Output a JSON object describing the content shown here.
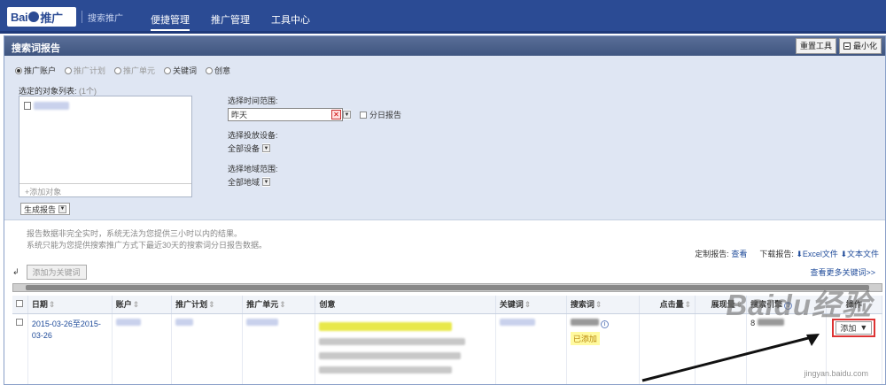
{
  "header": {
    "logo_text": "Bai",
    "logo_suffix": "推广",
    "logo_sub": "搜索推广",
    "nav": [
      {
        "label": "便捷管理",
        "active": true
      },
      {
        "label": "推广管理",
        "active": false
      },
      {
        "label": "工具中心",
        "active": false
      }
    ]
  },
  "panel": {
    "title": "搜索词报告",
    "reset_tool": "重置工具",
    "minimize": "最小化"
  },
  "filter": {
    "levels": [
      {
        "label": "推广账户",
        "checked": true,
        "disabled": false
      },
      {
        "label": "推广计划",
        "checked": false,
        "disabled": true
      },
      {
        "label": "推广单元",
        "checked": false,
        "disabled": true
      },
      {
        "label": "关键词",
        "checked": false,
        "disabled": false
      },
      {
        "label": "创意",
        "checked": false,
        "disabled": false
      }
    ],
    "objects_label": "选定的对象列表:",
    "objects_count": "(1个)",
    "add_object": "+添加对象",
    "generate": "生成报告",
    "time_label": "选择时间范围:",
    "time_value": "昨天",
    "split_by_day": "分日报告",
    "device_label": "选择投放设备:",
    "device_value": "全部设备",
    "region_label": "选择地域范围:",
    "region_value": "全部地域"
  },
  "notes": [
    "报告数据非完全实时，系统无法为您提供三小时以内的结果。",
    "系统只能为您提供搜索推广方式下最近30天的搜索词分日报告数据。"
  ],
  "report_actions": {
    "custom_label": "定制报告:",
    "custom_link": "查看",
    "download_label": "下载报告:",
    "excel": "Excel文件",
    "text": "文本文件"
  },
  "toolbar": {
    "add_keyword": "添加为关键词",
    "more_link": "查看更多关键词>>"
  },
  "table": {
    "columns": [
      "日期",
      "账户",
      "推广计划",
      "推广单元",
      "创意",
      "关键词",
      "搜索词",
      "点击量",
      "展现量",
      "搜索引擎",
      "操作"
    ],
    "row": {
      "date": "2015-03-26至2015-03-26",
      "status": "已添加",
      "engine_partial": "8",
      "action": "添加"
    }
  },
  "watermark": {
    "text": "Baidu经验",
    "sub": "jingyan.baidu.com"
  }
}
